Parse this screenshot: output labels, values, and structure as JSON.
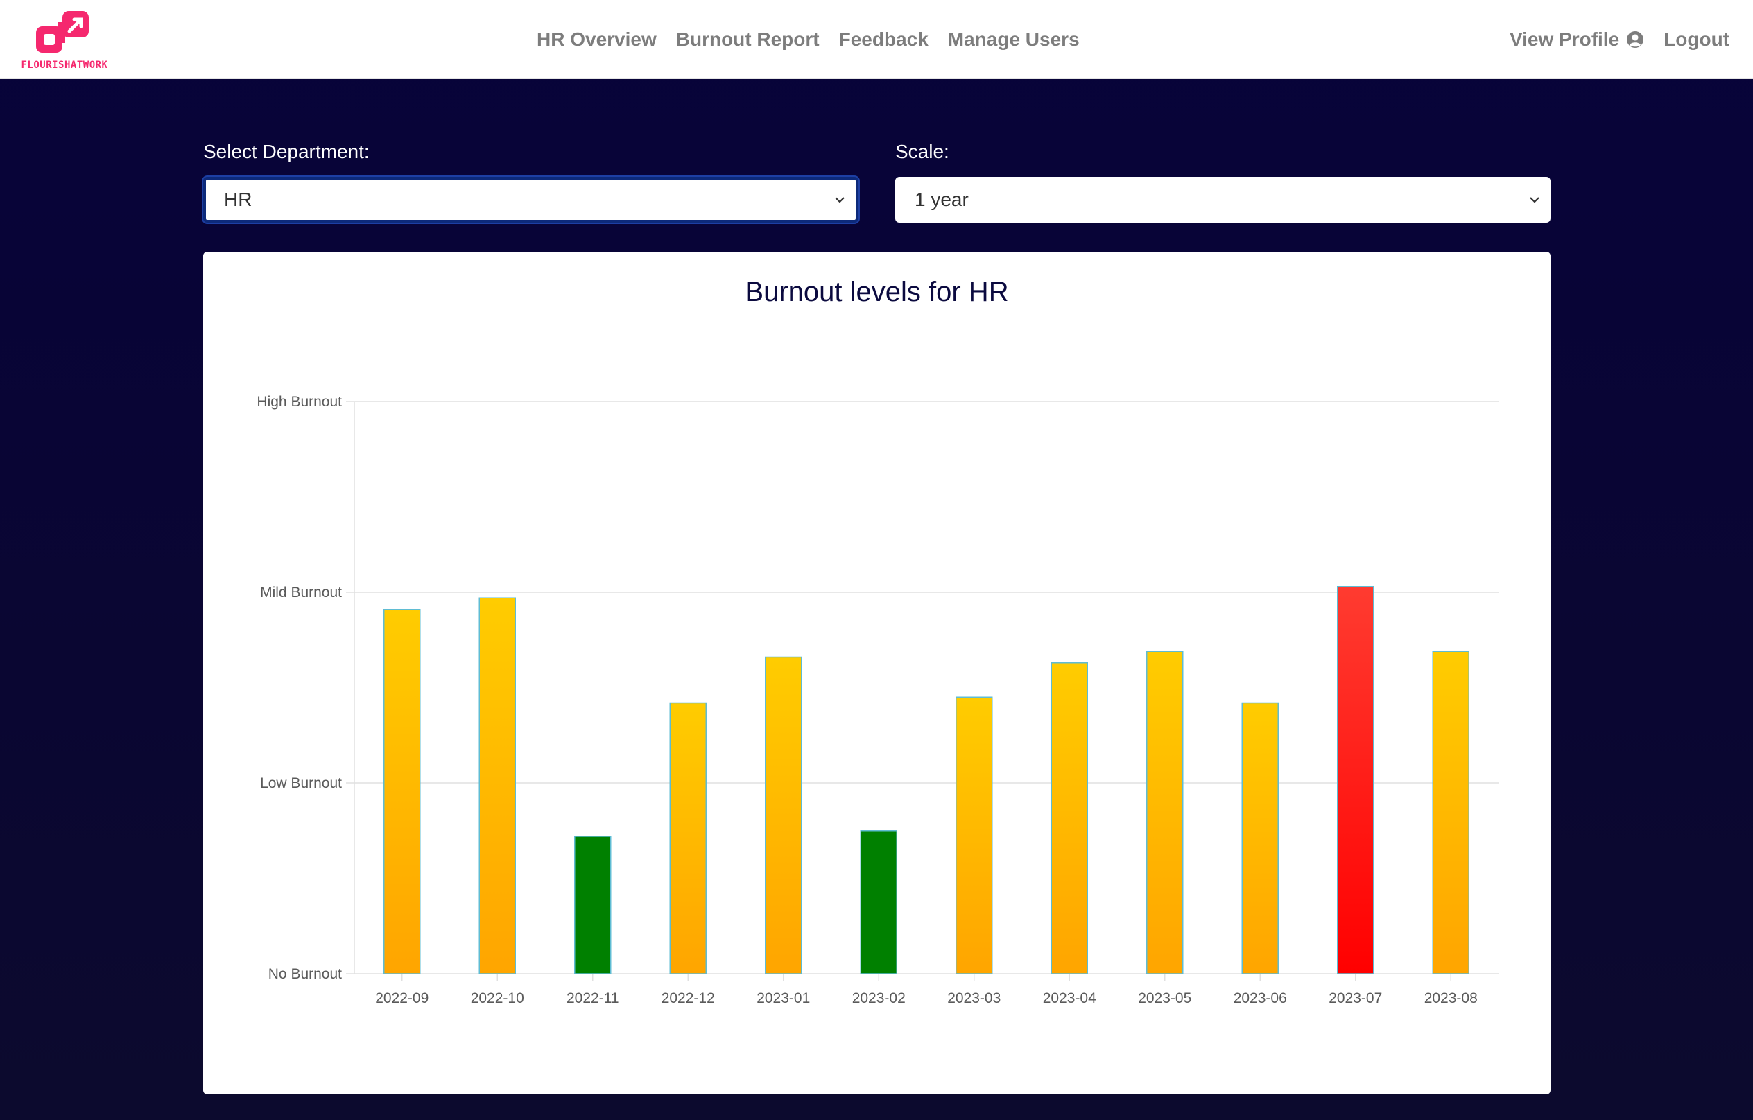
{
  "brand": {
    "name": "FLOURISHATWORK",
    "color": "#f5286e"
  },
  "nav": {
    "links": [
      "HR Overview",
      "Burnout Report",
      "Feedback",
      "Manage Users"
    ],
    "view_profile": "View Profile",
    "profile_icon": "user-circle-icon",
    "logout": "Logout"
  },
  "filters": {
    "department_label": "Select Department:",
    "department_value": "HR",
    "scale_label": "Scale:",
    "scale_value": "1 year"
  },
  "chart_data": {
    "type": "bar",
    "title": "Burnout levels for HR",
    "categories": [
      "2022-09",
      "2022-10",
      "2022-11",
      "2022-12",
      "2023-01",
      "2023-02",
      "2023-03",
      "2023-04",
      "2023-05",
      "2023-06",
      "2023-07",
      "2023-08"
    ],
    "values": [
      1.91,
      1.97,
      0.72,
      1.42,
      1.66,
      0.75,
      1.45,
      1.63,
      1.69,
      1.42,
      2.03,
      1.69
    ],
    "levels": [
      "mild",
      "mild",
      "low",
      "mild",
      "mild",
      "low",
      "mild",
      "mild",
      "mild",
      "mild",
      "high",
      "mild"
    ],
    "ylim": [
      0,
      3
    ],
    "yticks": [
      {
        "value": 0,
        "label": "No Burnout"
      },
      {
        "value": 1,
        "label": "Low Burnout"
      },
      {
        "value": 2,
        "label": "Mild Burnout"
      },
      {
        "value": 3,
        "label": "High Burnout"
      }
    ],
    "grid": true,
    "colors": {
      "low": "#008000",
      "mild_top": "#ffcc00",
      "mild_bottom": "#ffa500",
      "high_top": "#ff3b30",
      "high_bottom": "#ff0000",
      "bar_border": "#5fbcd3",
      "grid": "#e0e0e0"
    }
  }
}
